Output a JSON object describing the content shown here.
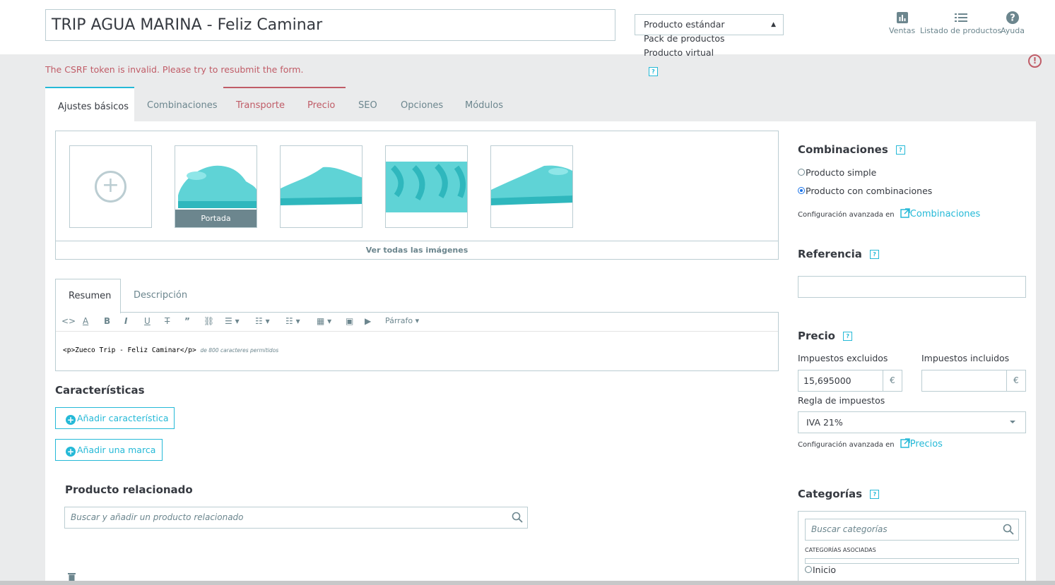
{
  "product": {
    "name": "TRIP AGUA MARINA - Feliz Caminar"
  },
  "product_type": {
    "selected": "Producto estándar",
    "options": [
      "Pack de productos",
      "Producto virtual"
    ]
  },
  "header_links": {
    "sales": "Ventas",
    "product_list": "Listado de productos",
    "help": "Ayuda"
  },
  "alert": {
    "message": "The CSRF token is invalid. Please try to resubmit the form."
  },
  "tabs": [
    "Ajustes básicos",
    "Combinaciones",
    "Transporte",
    "Precio",
    "SEO",
    "Opciones",
    "Módulos"
  ],
  "images": {
    "cover_label": "Portada",
    "see_all": "Ver todas las imágenes",
    "colors": {
      "product": "#5fd3d6",
      "product_dark": "#2fb7bd"
    }
  },
  "editor": {
    "tabs": [
      "Resumen",
      "Descripción"
    ],
    "paragraph_label": "Párrafo",
    "content": "<p>Zueco Trip - Feliz Caminar</p>",
    "counter": "de 800 caracteres permitidos"
  },
  "features": {
    "title": "Características",
    "add_feature": "Añadir característica",
    "add_brand": "Añadir una marca"
  },
  "related": {
    "title": "Producto relacionado",
    "placeholder": "Buscar y añadir un producto relacionado"
  },
  "combinations": {
    "title": "Combinaciones",
    "simple": "Producto simple",
    "with_combinations": "Producto con combinaciones",
    "selected": "with_combinations",
    "advanced_prefix": "Configuración avanzada en",
    "advanced_link": "Combinaciones"
  },
  "reference": {
    "title": "Referencia",
    "value": ""
  },
  "price": {
    "title": "Precio",
    "tax_excluded_label": "Impuestos excluidos",
    "tax_included_label": "Impuestos incluidos",
    "tax_excluded_value": "15,695000",
    "tax_included_value": "",
    "currency": "€",
    "tax_rule_label": "Regla de impuestos",
    "tax_rule_value": "IVA 21%",
    "advanced_prefix": "Configuración avanzada en",
    "advanced_link": "Precios"
  },
  "categories": {
    "title": "Categorías",
    "placeholder": "Buscar categorías",
    "associated_label": "CATEGORÍAS ASOCIADAS",
    "tree": [
      "Inicio"
    ]
  },
  "colors": {
    "accent": "#25b9d7",
    "error": "#c05c67",
    "border": "#bbcdd2",
    "muted": "#6c868e"
  }
}
